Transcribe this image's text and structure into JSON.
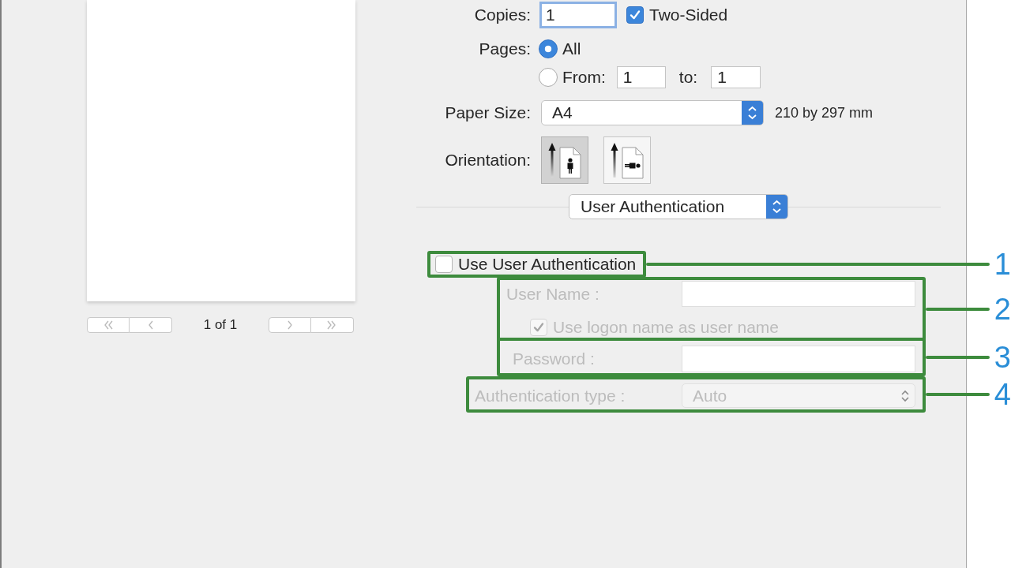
{
  "preview": {
    "page_indicator": "1 of 1",
    "nav_buttons": [
      {
        "kind": "first",
        "disabled": true
      },
      {
        "kind": "previous",
        "disabled": true
      },
      {
        "kind": "next",
        "disabled": true
      },
      {
        "kind": "last",
        "disabled": true
      }
    ]
  },
  "print_options": {
    "copies": {
      "label": "Copies:",
      "value": "1",
      "focused": true
    },
    "two_sided": {
      "label": "Two-Sided",
      "checked": true
    },
    "pages": {
      "label": "Pages:",
      "options": [
        {
          "kind": "all",
          "label": "All",
          "selected": true
        },
        {
          "kind": "range",
          "label": "From:",
          "selected": false,
          "from": "1",
          "to_label": "to:",
          "to": "1"
        }
      ]
    },
    "paper_size": {
      "label": "Paper Size:",
      "value": "A4",
      "dimensions": "210 by 297 mm"
    },
    "orientation": {
      "label": "Orientation:",
      "options": [
        {
          "kind": "portrait",
          "selected": true
        },
        {
          "kind": "landscape",
          "selected": false
        }
      ]
    }
  },
  "panel_menu": {
    "value": "User Authentication"
  },
  "authentication": {
    "groups": [
      {
        "callout": "1",
        "rows": [
          {
            "kind": "checkbox",
            "label": "Use User Authentication",
            "checked": false,
            "disabled": false
          }
        ]
      },
      {
        "callout": "2",
        "rows": [
          {
            "kind": "text_field",
            "label": "User Name :",
            "disabled": true
          },
          {
            "kind": "checkbox",
            "label": "Use logon name as user name",
            "checked": true,
            "disabled": true
          }
        ]
      },
      {
        "callout": "3",
        "rows": [
          {
            "kind": "text_field",
            "label": "Password :",
            "disabled": true
          }
        ]
      },
      {
        "callout": "4",
        "rows": [
          {
            "kind": "select",
            "label": "Authentication type :",
            "value": "Auto",
            "disabled": true
          }
        ]
      }
    ]
  }
}
